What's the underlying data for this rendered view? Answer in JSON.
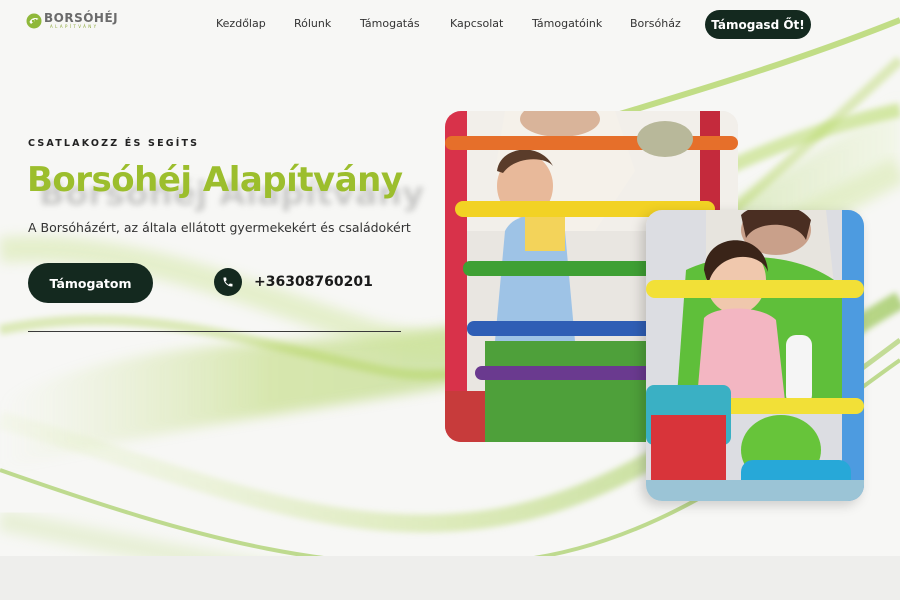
{
  "logo": {
    "name": "BORSÓHÉJ",
    "sub": "ALAPÍTVÁNY"
  },
  "nav": {
    "items": [
      {
        "label": "Kezdőlap"
      },
      {
        "label": "Rólunk"
      },
      {
        "label": "Támogatás"
      },
      {
        "label": "Kapcsolat"
      },
      {
        "label": "Támogatóink"
      },
      {
        "label": "Borsóház"
      }
    ],
    "cta_label": "Támogasd Őt!"
  },
  "hero": {
    "eyebrow": "CSATLAKOZZ ÉS SEGÍTS",
    "title": "Borsóhéj Alapítvány",
    "subtitle": "A Borsóházért, az általa ellátott gyermekekért és családokért",
    "button_label": "Támogatom",
    "phone": "+36308760201"
  },
  "images": [
    {
      "name": "child-at-bead-frame-photo",
      "icon": "photo"
    },
    {
      "name": "girl-playing-with-toys-photo",
      "icon": "photo"
    }
  ],
  "colors": {
    "accent_green": "#9cbe2d",
    "dark_button": "#14291f",
    "background": "#f7f7f5"
  }
}
